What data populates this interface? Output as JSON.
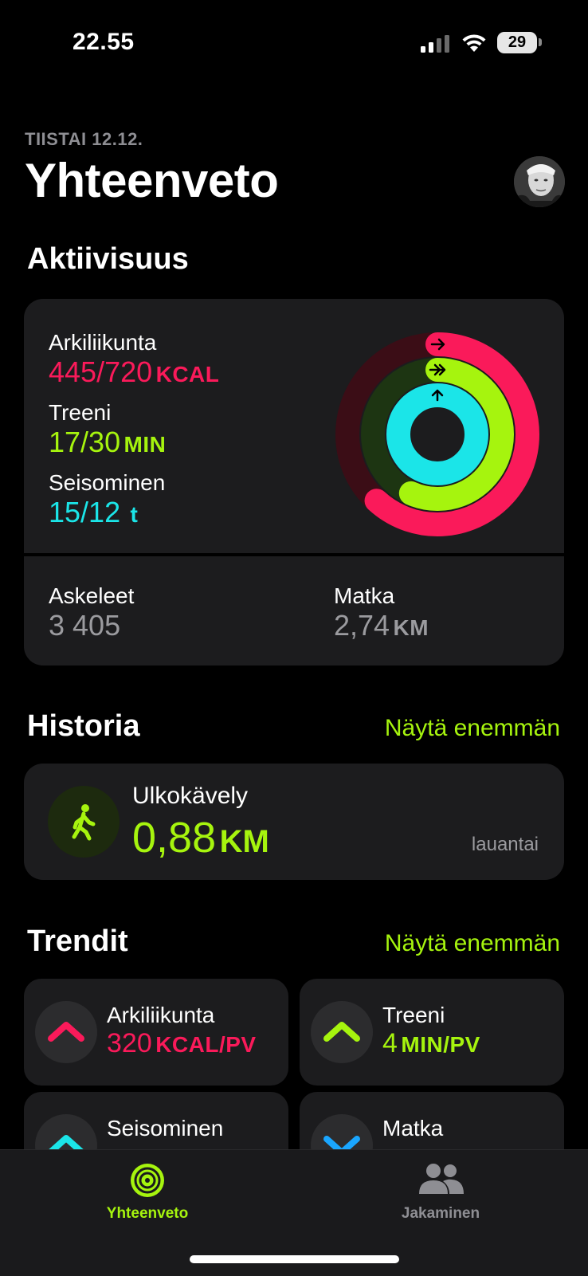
{
  "status_bar": {
    "time": "22.55",
    "battery": "29"
  },
  "header": {
    "date": "TIISTAI 12.12.",
    "title": "Yhteenveto"
  },
  "activity": {
    "heading": "Aktiivisuus",
    "move": {
      "label": "Arkiliikunta",
      "value": "445/720",
      "unit": "KCAL",
      "progress": 0.618,
      "color": "#fa1a5a"
    },
    "exercise": {
      "label": "Treeni",
      "value": "17/30",
      "unit": "MIN",
      "progress": 0.567,
      "color": "#a6f40e"
    },
    "stand": {
      "label": "Seisominen",
      "value": "15/12",
      "unit": "t",
      "progress": 1.25,
      "color": "#1be5e8"
    },
    "steps": {
      "label": "Askeleet",
      "value": "3 405"
    },
    "distance": {
      "label": "Matka",
      "value": "2,74",
      "unit": "KM"
    }
  },
  "history": {
    "heading": "Historia",
    "show_more": "Näytä enemmän",
    "item": {
      "name": "Ulkokävely",
      "value": "0,88",
      "unit": "KM",
      "day": "lauantai",
      "icon": "walking-figure-icon"
    }
  },
  "trends": {
    "heading": "Trendit",
    "show_more": "Näytä enemmän",
    "items": [
      {
        "label": "Arkiliikunta",
        "value": "320",
        "unit": "KCAL/PV",
        "direction": "up",
        "color": "#fa1a5a"
      },
      {
        "label": "Treeni",
        "value": "4",
        "unit": "MIN/PV",
        "direction": "up",
        "color": "#a6f40e"
      },
      {
        "label": "Seisominen",
        "direction": "up",
        "color": "#1be5e8"
      },
      {
        "label": "Matka",
        "direction": "down",
        "color": "#1aa6ff"
      }
    ]
  },
  "tabbar": {
    "tabs": [
      {
        "label": "Yhteenveto",
        "active": true,
        "icon": "activity-rings-icon"
      },
      {
        "label": "Jakaminen",
        "active": false,
        "icon": "people-icon"
      }
    ]
  }
}
